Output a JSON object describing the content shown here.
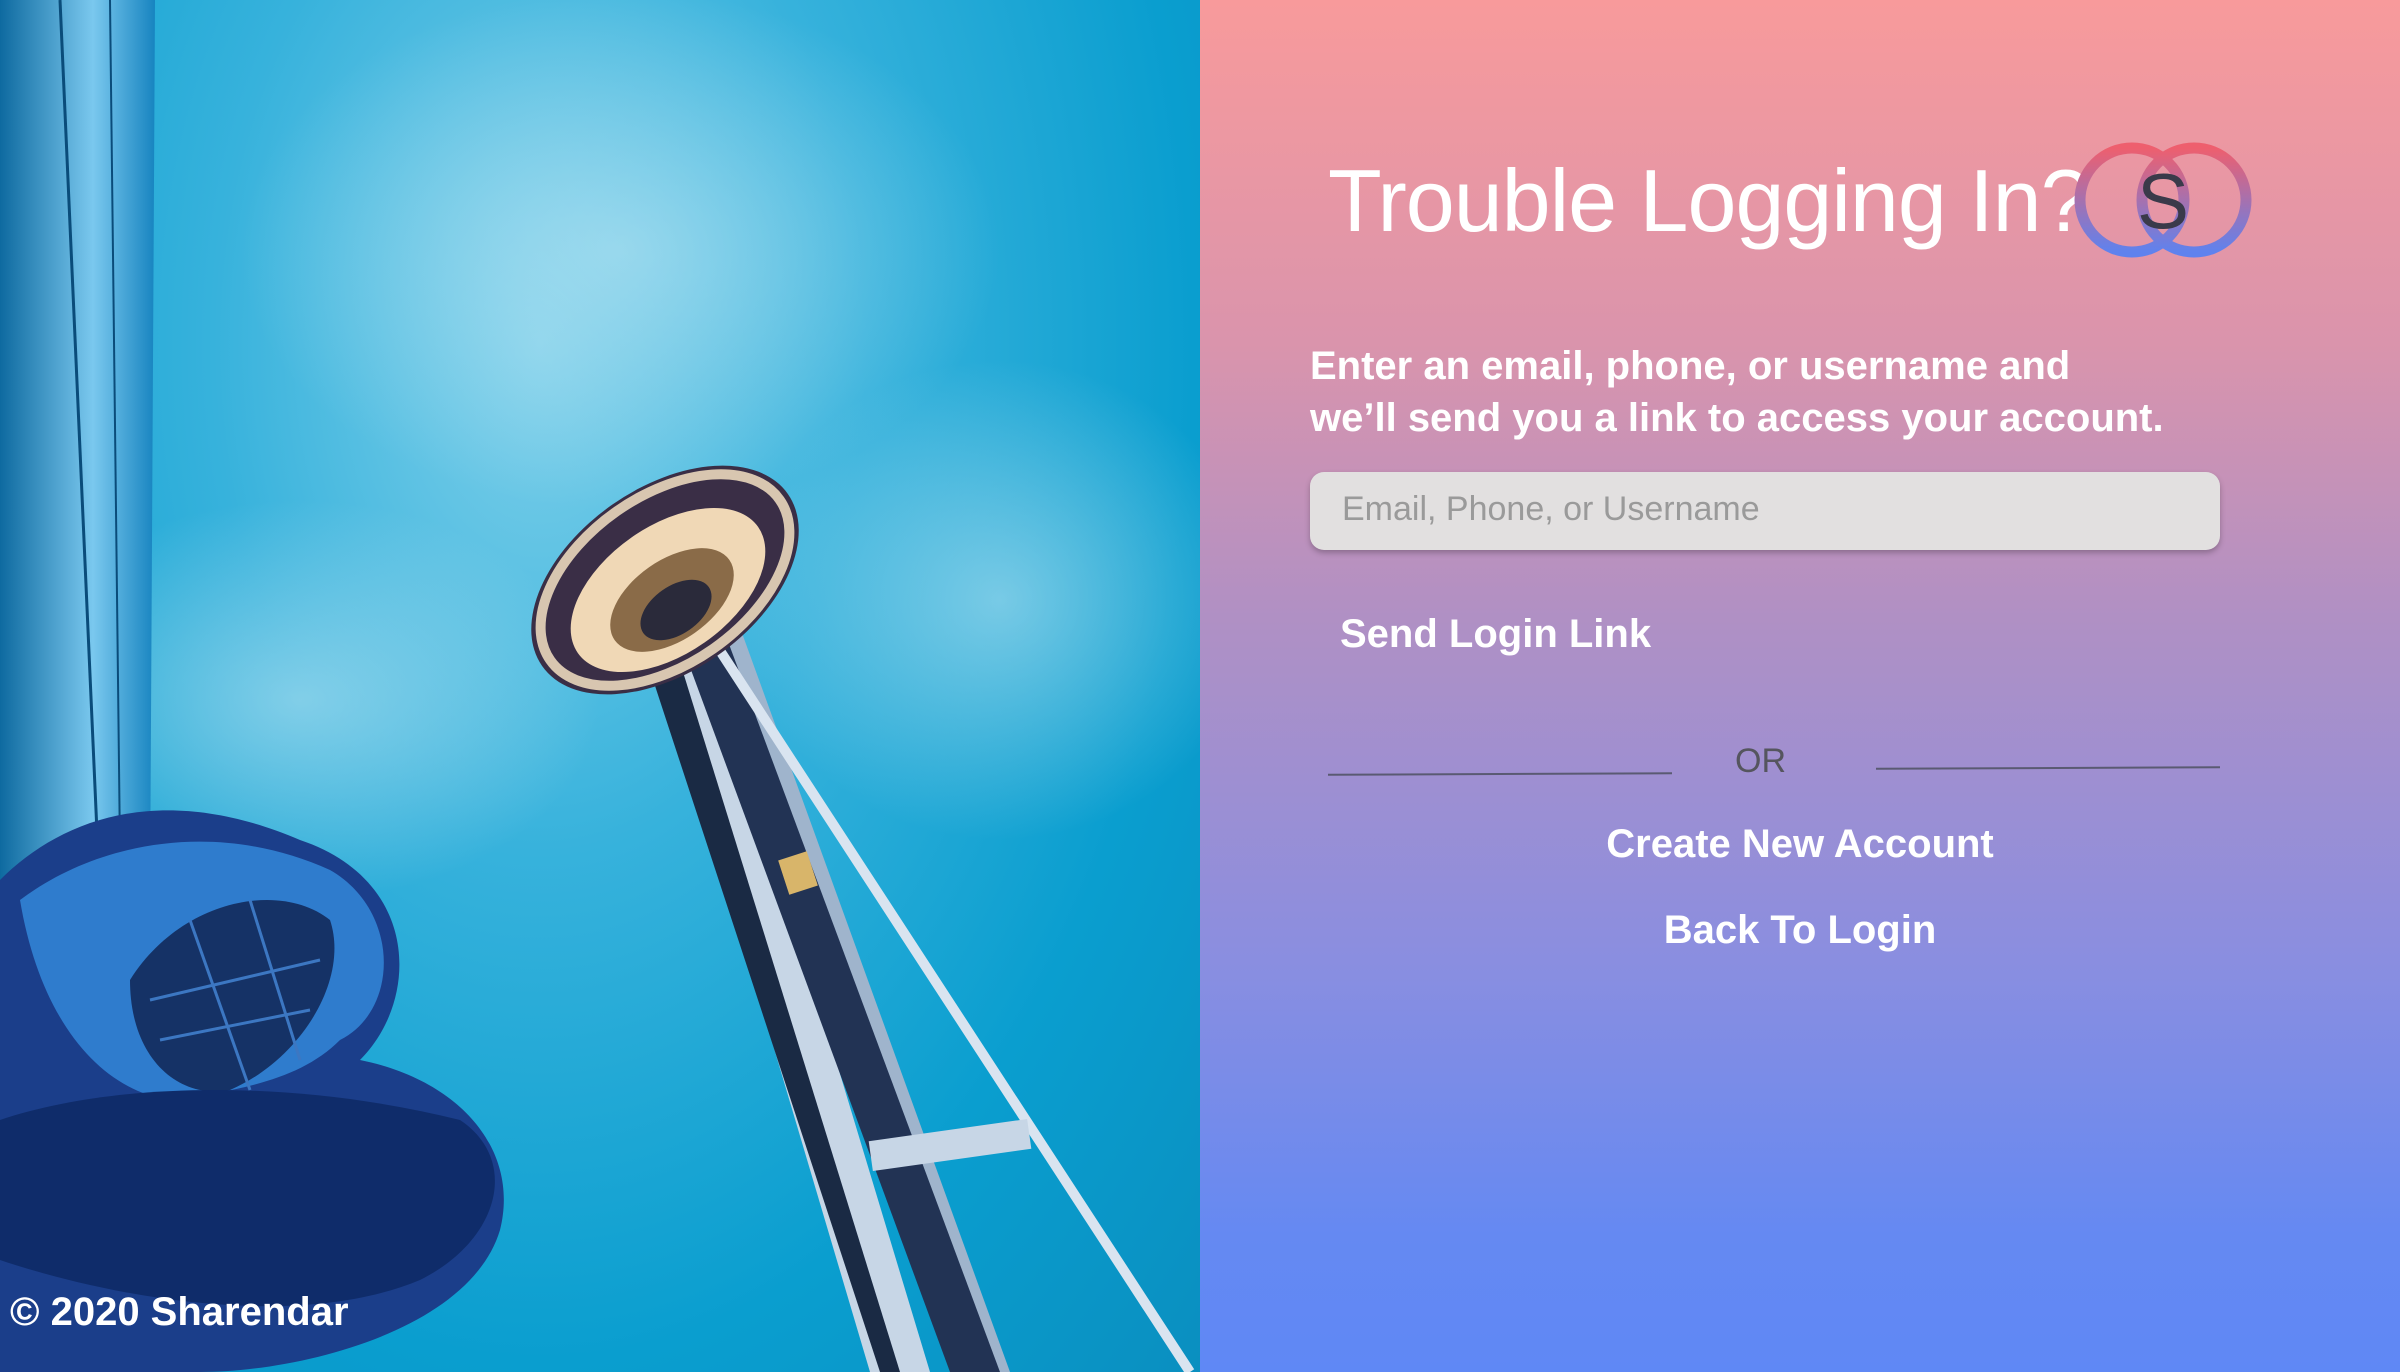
{
  "photo": {
    "copyright": "© 2020 Sharendar",
    "subject": "space-needle-photo"
  },
  "form": {
    "title": "Trouble Logging In?",
    "logo_letter": "S",
    "description_line1": "Enter an email, phone, or username and",
    "description_line2": "we’ll send you a link to access your account.",
    "input_placeholder": "Email, Phone, or Username",
    "input_value": "",
    "send_label": "Send Login Link",
    "or_label": "OR",
    "create_label": "Create New Account",
    "back_label": "Back To Login"
  },
  "colors": {
    "gradient_top": "#f89a9b",
    "gradient_bottom": "#5f88f5",
    "logo_ring_top": "#ee5f6e",
    "logo_ring_bottom": "#5f82ee"
  }
}
